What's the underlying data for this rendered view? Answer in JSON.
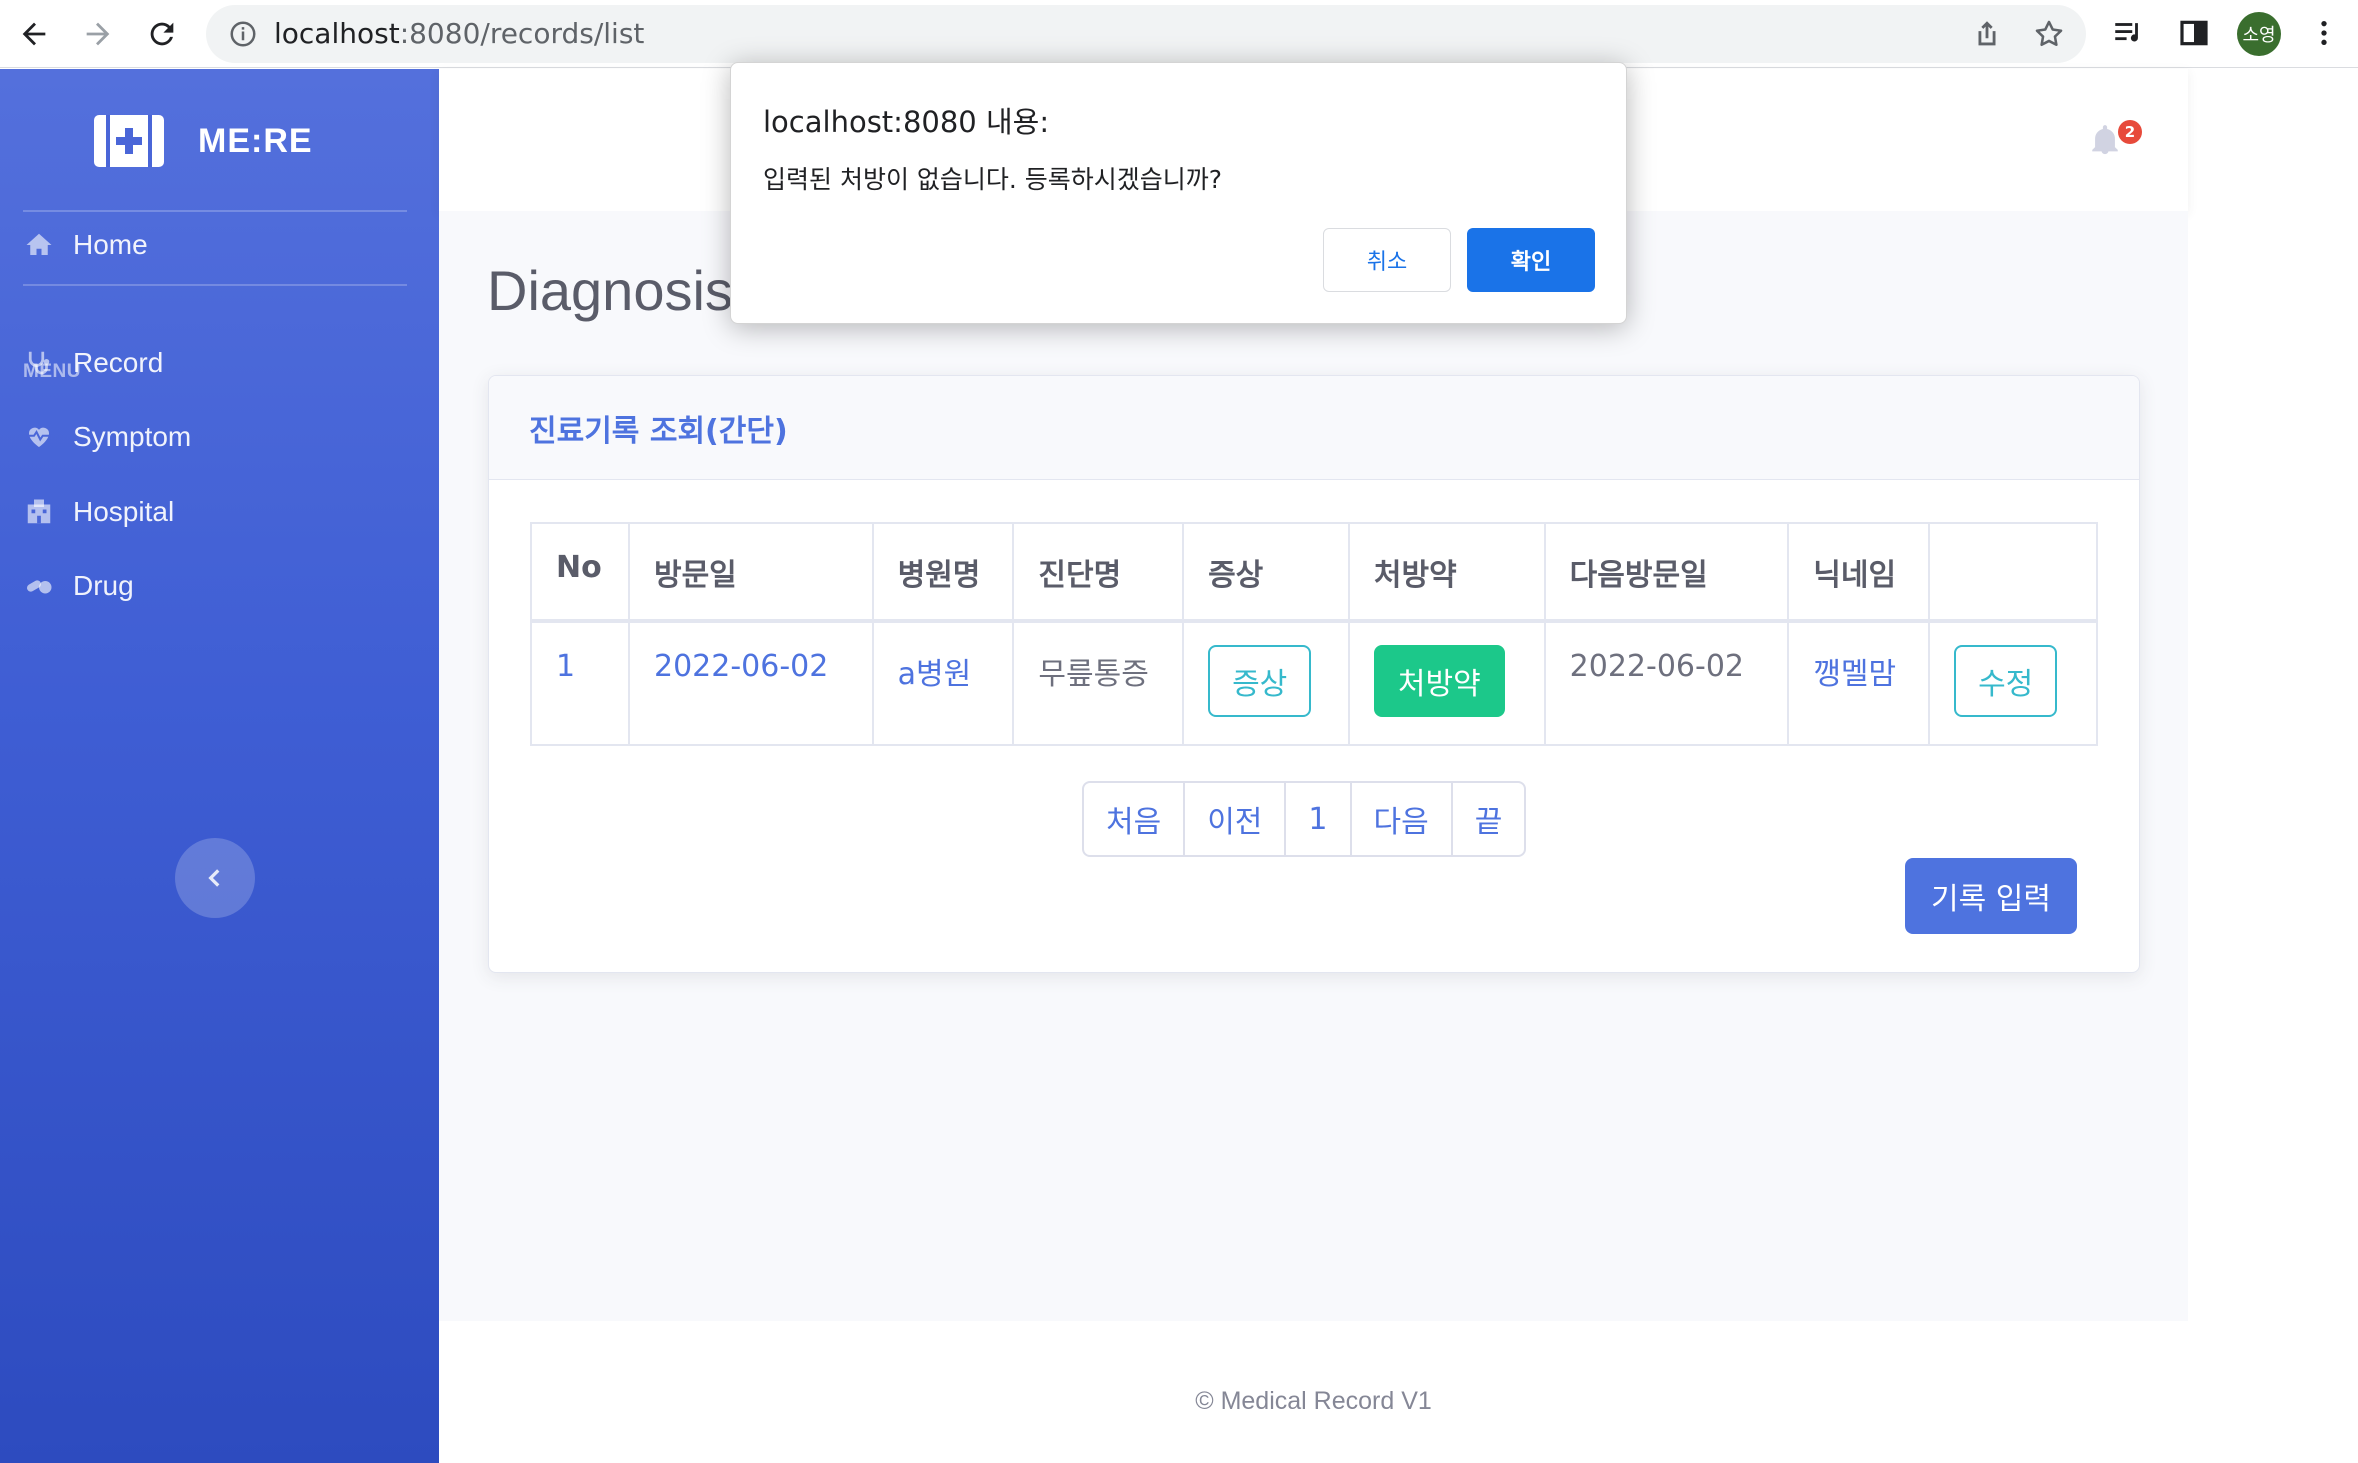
{
  "browser": {
    "url_host": "localhost",
    "url_rest": ":8080/records/list",
    "profile_initials": "소영"
  },
  "sidebar": {
    "brand": "ME:RE",
    "menu_heading": "MENU",
    "items": [
      {
        "label": "Home",
        "icon": "home-icon"
      },
      {
        "label": "Record",
        "icon": "stethoscope-icon"
      },
      {
        "label": "Symptom",
        "icon": "heartbeat-icon"
      },
      {
        "label": "Hospital",
        "icon": "hospital-icon"
      },
      {
        "label": "Drug",
        "icon": "pills-icon"
      }
    ]
  },
  "topbar": {
    "notification_count": "2"
  },
  "page": {
    "title": "Diagnosis",
    "card_title": "진료기록 조회(간단)"
  },
  "table": {
    "headers": [
      "No",
      "방문일",
      "병원명",
      "진단명",
      "증상",
      "처방약",
      "다음방문일",
      "닉네임",
      ""
    ],
    "rows": [
      {
        "no": "1",
        "visit_date": "2022-06-02",
        "hospital": "a병원",
        "diagnosis": "무릎통증",
        "symptom_btn": "증상",
        "prescription_btn": "처방약",
        "next_visit": "2022-06-02",
        "nickname": "깽멜맘",
        "edit_btn": "수정"
      }
    ]
  },
  "pagination": {
    "first": "처음",
    "prev": "이전",
    "page": "1",
    "next": "다음",
    "last": "끝"
  },
  "actions": {
    "add_record": "기록 입력"
  },
  "footer": {
    "text": "© Medical Record V1"
  },
  "dialog": {
    "title": "localhost:8080 내용:",
    "message": "입력된 처방이 없습니다. 등록하시겠습니까?",
    "cancel": "취소",
    "ok": "확인"
  },
  "colors": {
    "primary": "#4e73df",
    "success": "#1cc88a",
    "info": "#36b9cc",
    "danger": "#e74a3b",
    "dialog_blue": "#1a73e8"
  }
}
